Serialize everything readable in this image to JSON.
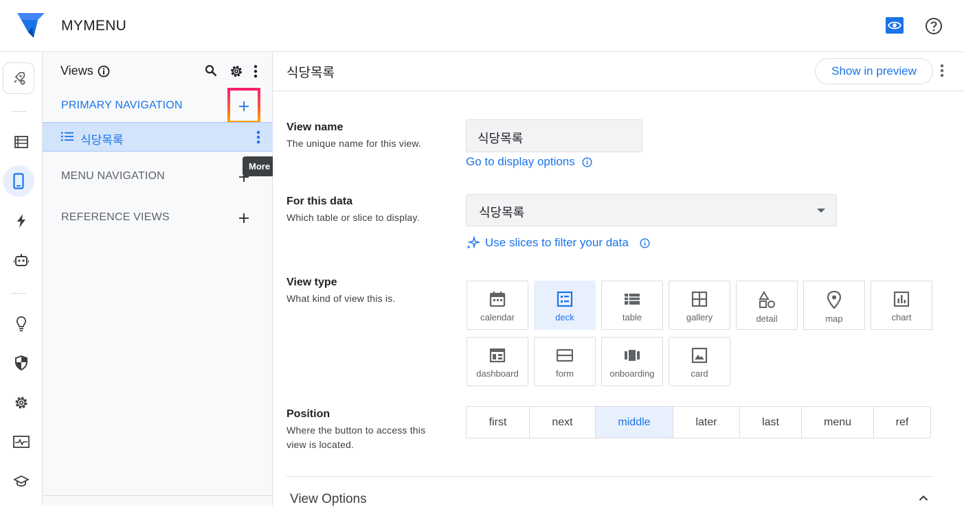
{
  "app": {
    "title": "MYMENU",
    "brand_color": "#1a73e8",
    "icons": [
      "appsheet-logo-icon",
      "preview-eye-icon",
      "help-icon"
    ]
  },
  "rail": {
    "items": [
      "rocket-icon",
      "data-table-icon",
      "phone-app-icon",
      "automation-bolt-icon",
      "bot-icon",
      "lightbulb-icon",
      "security-shield-icon",
      "settings-gear-icon",
      "monitor-icon",
      "learn-cap-icon"
    ],
    "active": "phone-app-icon"
  },
  "views_panel": {
    "title": "Views",
    "sections": {
      "primary": "PRIMARY NAVIGATION",
      "menu": "MENU NAVIGATION",
      "reference": "REFERENCE VIEWS"
    },
    "primary_items": [
      {
        "label": "식당목록"
      }
    ],
    "tooltip": "More",
    "add_symbol": "+"
  },
  "main": {
    "title": "식당목록",
    "preview_button": "Show in preview",
    "view_name": {
      "label": "View name",
      "help": "The unique name for this view.",
      "value": "식당목록",
      "link": "Go to display options"
    },
    "for_data": {
      "label": "For this data",
      "help": "Which table or slice to display.",
      "value": "식당목록",
      "link": "Use slices to filter your data"
    },
    "view_type": {
      "label": "View type",
      "help": "What kind of view this is.",
      "options": [
        "calendar",
        "deck",
        "table",
        "gallery",
        "detail",
        "map",
        "chart",
        "dashboard",
        "form",
        "onboarding",
        "card"
      ],
      "selected": "deck"
    },
    "position": {
      "label": "Position",
      "help_line1": "Where the button to access this",
      "help_line2": "view is located.",
      "options": [
        "first",
        "next",
        "middle",
        "later",
        "last",
        "menu",
        "ref"
      ],
      "selected": "middle"
    },
    "view_options": {
      "title": "View Options"
    }
  }
}
